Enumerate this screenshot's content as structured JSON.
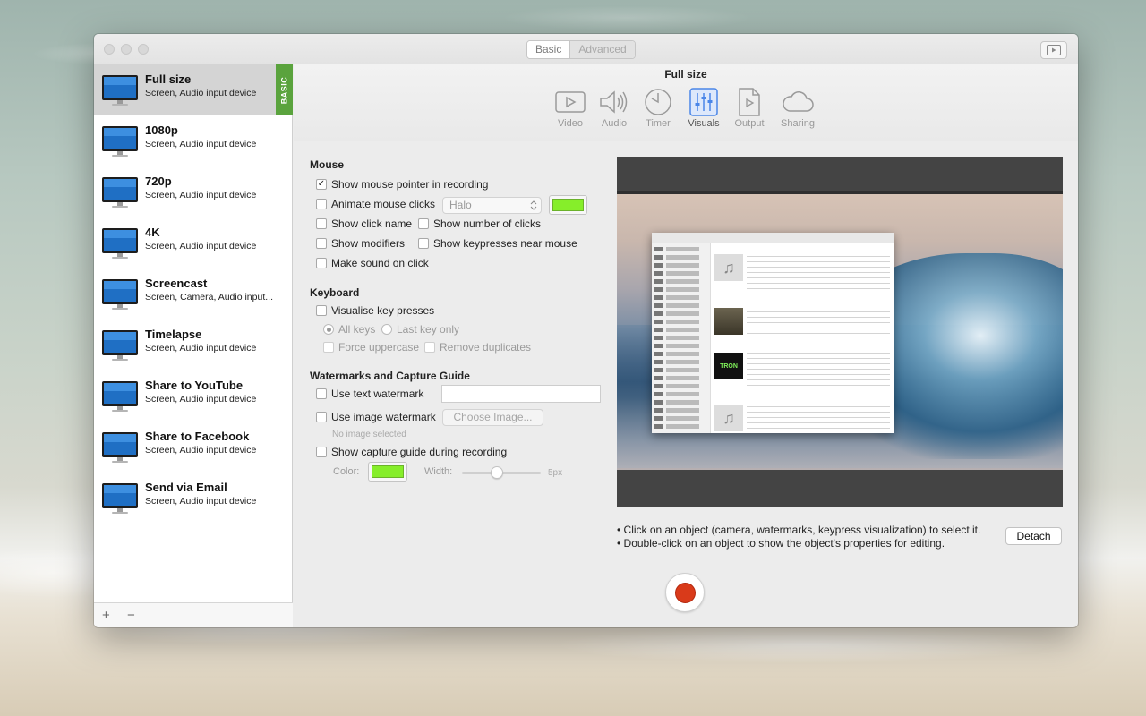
{
  "titlebar": {
    "segment_basic": "Basic",
    "segment_advanced": "Advanced"
  },
  "sidebar": {
    "items": [
      {
        "name": "Full size",
        "sub": "Screen, Audio input device",
        "tag": "BASIC"
      },
      {
        "name": "1080p",
        "sub": "Screen, Audio input device"
      },
      {
        "name": "720p",
        "sub": "Screen, Audio input device"
      },
      {
        "name": "4K",
        "sub": "Screen, Audio input device"
      },
      {
        "name": "Screencast",
        "sub": "Screen, Camera, Audio input..."
      },
      {
        "name": "Timelapse",
        "sub": "Screen, Audio input device"
      },
      {
        "name": "Share to YouTube",
        "sub": "Screen, Audio input device"
      },
      {
        "name": "Share to Facebook",
        "sub": "Screen, Audio input device"
      },
      {
        "name": "Send via Email",
        "sub": "Screen, Audio input device"
      }
    ],
    "add_label": "+",
    "remove_label": "−"
  },
  "toolbar": {
    "title": "Full size",
    "tabs": [
      {
        "label": "Video",
        "icon": "play-icon"
      },
      {
        "label": "Audio",
        "icon": "speaker-icon"
      },
      {
        "label": "Timer",
        "icon": "clock-icon"
      },
      {
        "label": "Visuals",
        "icon": "sliders-icon"
      },
      {
        "label": "Output",
        "icon": "document-icon"
      },
      {
        "label": "Sharing",
        "icon": "cloud-icon"
      }
    ],
    "active_tab": "Visuals"
  },
  "mouse": {
    "title": "Mouse",
    "show_pointer": "Show mouse pointer in recording",
    "animate_clicks": "Animate mouse clicks",
    "animation_style": "Halo",
    "click_color": "#86ee2a",
    "show_click_name": "Show click name",
    "show_click_number": "Show number of clicks",
    "show_modifiers": "Show modifiers",
    "show_keypresses_near": "Show keypresses near mouse",
    "make_sound": "Make sound on click"
  },
  "keyboard": {
    "title": "Keyboard",
    "visualise": "Visualise key presses",
    "all_keys": "All keys",
    "last_key": "Last key only",
    "force_uppercase": "Force uppercase",
    "remove_duplicates": "Remove duplicates"
  },
  "watermarks": {
    "title": "Watermarks and Capture Guide",
    "text_watermark": "Use text watermark",
    "text_watermark_value": "",
    "image_watermark": "Use image watermark",
    "choose_image": "Choose Image...",
    "no_image": "No image selected",
    "capture_guide": "Show capture guide during recording",
    "color_label": "Color:",
    "width_label": "Width:",
    "width_value": "5px"
  },
  "preview": {
    "hint_1": "• Click on an object (camera, watermarks, keypress visualization) to select it.",
    "hint_2": "• Double-click on an object to show the object's properties for editing.",
    "detach": "Detach"
  },
  "colors": {
    "accent_green": "#5aa33d",
    "record_red": "#d93a1a"
  }
}
